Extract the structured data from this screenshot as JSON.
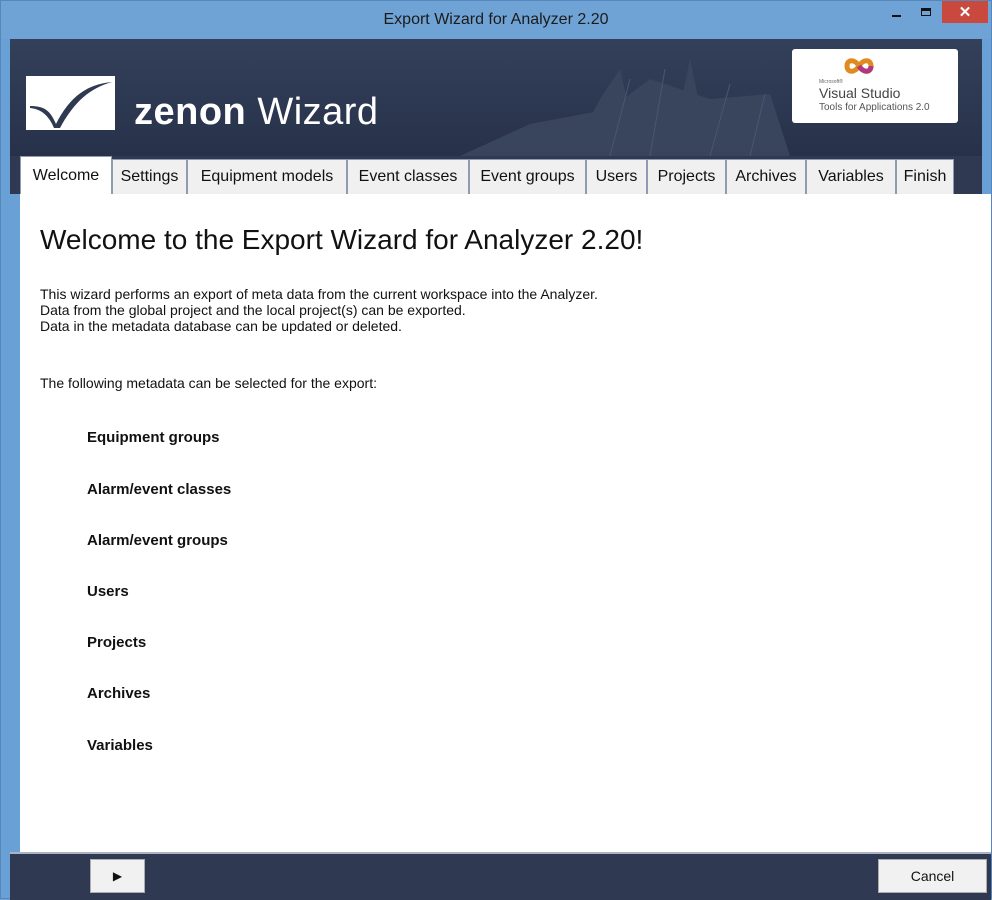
{
  "window": {
    "title": "Export Wizard for Analyzer 2.20",
    "minimize_icon": "minimize-icon",
    "maximize_icon": "maximize-icon",
    "close_glyph": "✕"
  },
  "banner": {
    "product_name_bold": "zenon",
    "product_name_rest": " Wizard",
    "badge_microsoft": "Microsoft®",
    "badge_title": "Visual Studio",
    "badge_subtitle": "Tools for Applications 2.0"
  },
  "tabs": [
    {
      "label": "Welcome",
      "active": true
    },
    {
      "label": "Settings",
      "active": false
    },
    {
      "label": "Equipment models",
      "active": false
    },
    {
      "label": "Event classes",
      "active": false
    },
    {
      "label": "Event groups",
      "active": false
    },
    {
      "label": "Users",
      "active": false
    },
    {
      "label": "Projects",
      "active": false
    },
    {
      "label": "Archives",
      "active": false
    },
    {
      "label": "Variables",
      "active": false
    },
    {
      "label": "Finish",
      "active": false
    }
  ],
  "content": {
    "heading": "Welcome to the Export Wizard for Analyzer 2.20!",
    "intro_lines": [
      "This wizard performs an export of meta data from the current workspace into the Analyzer.",
      "Data from the global project and the local project(s) can be exported.",
      "Data in the metadata database can be updated or deleted."
    ],
    "list_caption": "The following metadata can be selected for the export:",
    "items": [
      "Equipment groups",
      "Alarm/event classes",
      "Alarm/event groups",
      "Users",
      "Projects",
      "Archives",
      "Variables"
    ]
  },
  "footer": {
    "next_glyph": "▶",
    "cancel_label": "Cancel"
  },
  "colors": {
    "title_bar": "#6fa3d6",
    "banner": "#2f3a52",
    "close_button": "#c9493e"
  }
}
